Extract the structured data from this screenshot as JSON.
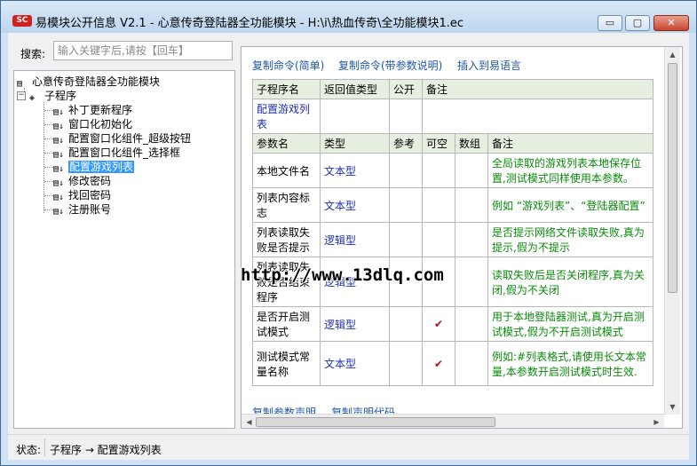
{
  "window": {
    "title": "易模块公开信息 V2.1 - 心意传奇登陆器全功能模块 - H:\\i\\热血传奇\\全功能模块1.ec",
    "app_icon_text": "SC",
    "minimize": "▭",
    "maximize": "▢",
    "close": "✕"
  },
  "search": {
    "label": "搜索:",
    "placeholder": "输入关键字后,请按【回车】"
  },
  "tree": {
    "root": "心意传奇登陆器全功能模块",
    "group": "子程序",
    "items": [
      "补丁更新程序",
      "窗口化初始化",
      "配置窗口化组件_超级按钮",
      "配置窗口化组件_选择框",
      "配置游戏列表",
      "修改密码",
      "找回密码",
      "注册账号"
    ],
    "selected_index": 4
  },
  "actions": {
    "copy_simple": "复制命令(简单)",
    "copy_with_params": "复制命令(带参数说明)",
    "insert": "插入到易语言",
    "copy_param_decl": "复制参数声明",
    "copy_decl_code": "复制声明代码"
  },
  "table": {
    "header1": [
      "子程序名",
      "返回值类型",
      "公开",
      "备注"
    ],
    "sub_name": "配置游戏列表",
    "header2": [
      "参数名",
      "类型",
      "参考",
      "可空",
      "数组",
      "备注"
    ],
    "params": [
      {
        "name": "本地文件名",
        "type": "文本型",
        "ref": "",
        "nullable": "",
        "array": "",
        "note": "全局读取的游戏列表本地保存位置,测试模式同样使用本参数。"
      },
      {
        "name": "列表内容标志",
        "type": "文本型",
        "ref": "",
        "nullable": "",
        "array": "",
        "note": "例如 “游戏列表”、“登陆器配置”"
      },
      {
        "name": "列表读取失败是否提示",
        "type": "逻辑型",
        "ref": "",
        "nullable": "",
        "array": "",
        "note": "是否提示网络文件读取失败,真为提示,假为不提示"
      },
      {
        "name": "列表读取失败是否结束程序",
        "type": "逻辑型",
        "ref": "",
        "nullable": "",
        "array": "",
        "note": "读取失败后是否关闭程序,真为关闭,假为不关闭"
      },
      {
        "name": "是否开启测试模式",
        "type": "逻辑型",
        "ref": "",
        "nullable": "✔",
        "array": "",
        "note": "用于本地登陆器测试,真为开启测试模式,假为不开启测试模式"
      },
      {
        "name": "测试模式常量名称",
        "type": "文本型",
        "ref": "",
        "nullable": "✔",
        "array": "",
        "note": "例如:#列表格式,请使用长文本常量,本参数开启测试模式时生效."
      }
    ]
  },
  "watermark": "http://www.13dlq.com",
  "status": {
    "label": "状态:",
    "text": "子程序 → 配置游戏列表"
  }
}
